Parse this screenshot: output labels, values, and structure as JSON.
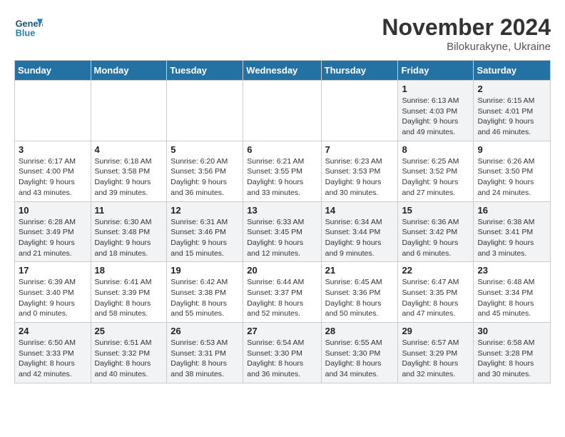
{
  "logo": {
    "line1": "General",
    "line2": "Blue"
  },
  "title": "November 2024",
  "subtitle": "Bilokurakyne, Ukraine",
  "days_header": [
    "Sunday",
    "Monday",
    "Tuesday",
    "Wednesday",
    "Thursday",
    "Friday",
    "Saturday"
  ],
  "weeks": [
    [
      {
        "day": "",
        "info": ""
      },
      {
        "day": "",
        "info": ""
      },
      {
        "day": "",
        "info": ""
      },
      {
        "day": "",
        "info": ""
      },
      {
        "day": "",
        "info": ""
      },
      {
        "day": "1",
        "info": "Sunrise: 6:13 AM\nSunset: 4:03 PM\nDaylight: 9 hours and 49 minutes."
      },
      {
        "day": "2",
        "info": "Sunrise: 6:15 AM\nSunset: 4:01 PM\nDaylight: 9 hours and 46 minutes."
      }
    ],
    [
      {
        "day": "3",
        "info": "Sunrise: 6:17 AM\nSunset: 4:00 PM\nDaylight: 9 hours and 43 minutes."
      },
      {
        "day": "4",
        "info": "Sunrise: 6:18 AM\nSunset: 3:58 PM\nDaylight: 9 hours and 39 minutes."
      },
      {
        "day": "5",
        "info": "Sunrise: 6:20 AM\nSunset: 3:56 PM\nDaylight: 9 hours and 36 minutes."
      },
      {
        "day": "6",
        "info": "Sunrise: 6:21 AM\nSunset: 3:55 PM\nDaylight: 9 hours and 33 minutes."
      },
      {
        "day": "7",
        "info": "Sunrise: 6:23 AM\nSunset: 3:53 PM\nDaylight: 9 hours and 30 minutes."
      },
      {
        "day": "8",
        "info": "Sunrise: 6:25 AM\nSunset: 3:52 PM\nDaylight: 9 hours and 27 minutes."
      },
      {
        "day": "9",
        "info": "Sunrise: 6:26 AM\nSunset: 3:50 PM\nDaylight: 9 hours and 24 minutes."
      }
    ],
    [
      {
        "day": "10",
        "info": "Sunrise: 6:28 AM\nSunset: 3:49 PM\nDaylight: 9 hours and 21 minutes."
      },
      {
        "day": "11",
        "info": "Sunrise: 6:30 AM\nSunset: 3:48 PM\nDaylight: 9 hours and 18 minutes."
      },
      {
        "day": "12",
        "info": "Sunrise: 6:31 AM\nSunset: 3:46 PM\nDaylight: 9 hours and 15 minutes."
      },
      {
        "day": "13",
        "info": "Sunrise: 6:33 AM\nSunset: 3:45 PM\nDaylight: 9 hours and 12 minutes."
      },
      {
        "day": "14",
        "info": "Sunrise: 6:34 AM\nSunset: 3:44 PM\nDaylight: 9 hours and 9 minutes."
      },
      {
        "day": "15",
        "info": "Sunrise: 6:36 AM\nSunset: 3:42 PM\nDaylight: 9 hours and 6 minutes."
      },
      {
        "day": "16",
        "info": "Sunrise: 6:38 AM\nSunset: 3:41 PM\nDaylight: 9 hours and 3 minutes."
      }
    ],
    [
      {
        "day": "17",
        "info": "Sunrise: 6:39 AM\nSunset: 3:40 PM\nDaylight: 9 hours and 0 minutes."
      },
      {
        "day": "18",
        "info": "Sunrise: 6:41 AM\nSunset: 3:39 PM\nDaylight: 8 hours and 58 minutes."
      },
      {
        "day": "19",
        "info": "Sunrise: 6:42 AM\nSunset: 3:38 PM\nDaylight: 8 hours and 55 minutes."
      },
      {
        "day": "20",
        "info": "Sunrise: 6:44 AM\nSunset: 3:37 PM\nDaylight: 8 hours and 52 minutes."
      },
      {
        "day": "21",
        "info": "Sunrise: 6:45 AM\nSunset: 3:36 PM\nDaylight: 8 hours and 50 minutes."
      },
      {
        "day": "22",
        "info": "Sunrise: 6:47 AM\nSunset: 3:35 PM\nDaylight: 8 hours and 47 minutes."
      },
      {
        "day": "23",
        "info": "Sunrise: 6:48 AM\nSunset: 3:34 PM\nDaylight: 8 hours and 45 minutes."
      }
    ],
    [
      {
        "day": "24",
        "info": "Sunrise: 6:50 AM\nSunset: 3:33 PM\nDaylight: 8 hours and 42 minutes."
      },
      {
        "day": "25",
        "info": "Sunrise: 6:51 AM\nSunset: 3:32 PM\nDaylight: 8 hours and 40 minutes."
      },
      {
        "day": "26",
        "info": "Sunrise: 6:53 AM\nSunset: 3:31 PM\nDaylight: 8 hours and 38 minutes."
      },
      {
        "day": "27",
        "info": "Sunrise: 6:54 AM\nSunset: 3:30 PM\nDaylight: 8 hours and 36 minutes."
      },
      {
        "day": "28",
        "info": "Sunrise: 6:55 AM\nSunset: 3:30 PM\nDaylight: 8 hours and 34 minutes."
      },
      {
        "day": "29",
        "info": "Sunrise: 6:57 AM\nSunset: 3:29 PM\nDaylight: 8 hours and 32 minutes."
      },
      {
        "day": "30",
        "info": "Sunrise: 6:58 AM\nSunset: 3:28 PM\nDaylight: 8 hours and 30 minutes."
      }
    ]
  ]
}
